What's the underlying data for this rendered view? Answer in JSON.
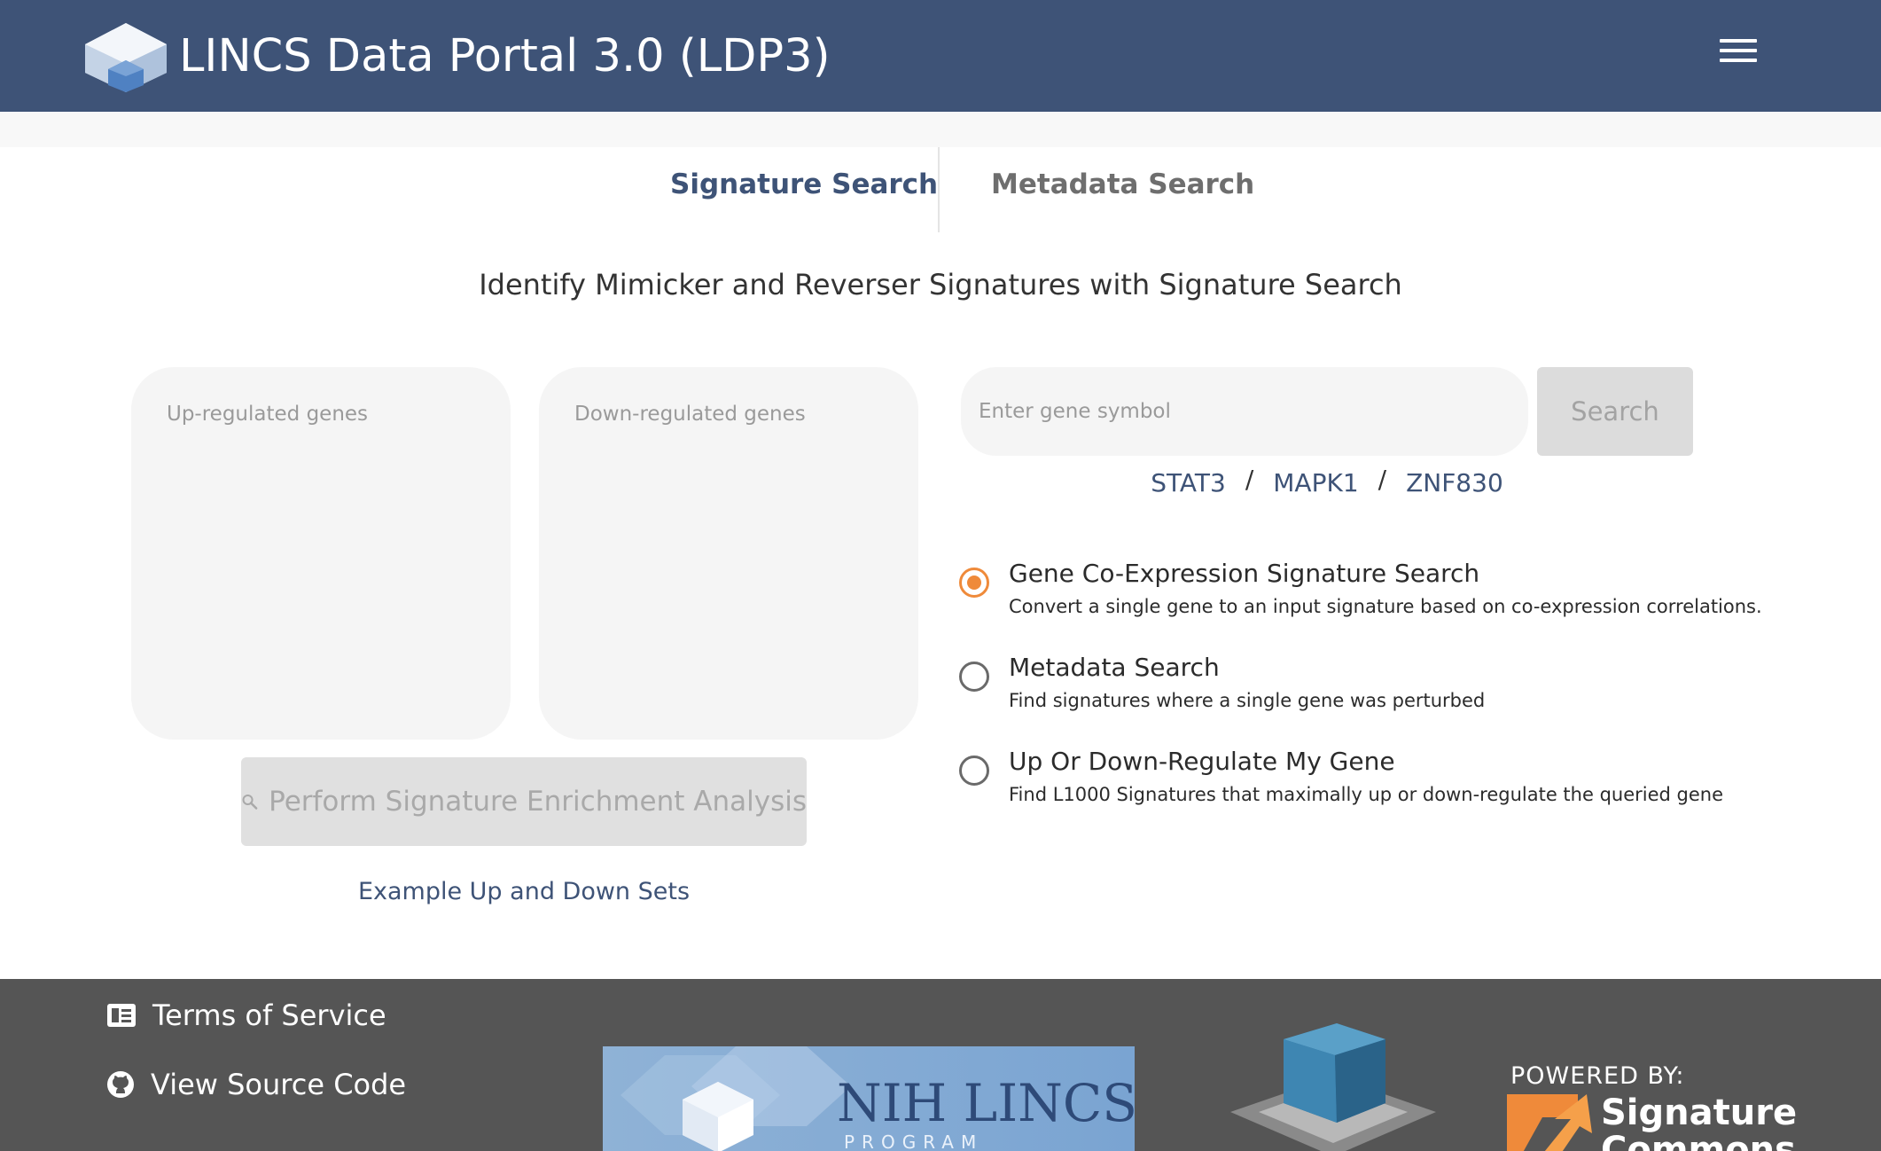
{
  "header": {
    "title": "LINCS Data Portal 3.0 (LDP3)",
    "logo_icon": "lincs-cube-logo",
    "menu_icon": "hamburger-menu-icon",
    "background_color": "#3e5377"
  },
  "tabs": [
    {
      "label": "Signature Search",
      "active": true
    },
    {
      "label": "Metadata Search",
      "active": false
    }
  ],
  "headline": "Identify Mimicker and Reverser Signatures with Signature Search",
  "signature_input": {
    "up_placeholder": "Up-regulated genes",
    "down_placeholder": "Down-regulated genes",
    "enrich_button_label": "Perform Signature Enrichment Analysis",
    "example_link": "Example Up and Down Sets"
  },
  "gene_search": {
    "placeholder": "Enter gene symbol",
    "button_label": "Search",
    "examples": [
      "STAT3",
      "MAPK1",
      "ZNF830"
    ],
    "separator": "/"
  },
  "search_modes": [
    {
      "title": "Gene Co-Expression Signature Search",
      "description": "Convert a single gene to an input signature based on co-expression correlations.",
      "selected": true
    },
    {
      "title": "Metadata Search",
      "description": "Find signatures where a single gene was perturbed",
      "selected": false
    },
    {
      "title": "Up Or Down-Regulate My Gene",
      "description": "Find L1000 Signatures that maximally up or down-regulate the queried gene",
      "selected": false
    }
  ],
  "footer": {
    "links": [
      {
        "label": "Terms of Service",
        "icon": "document-icon"
      },
      {
        "label": "View Source Code",
        "icon": "github-icon"
      }
    ],
    "nih_banner": {
      "title": "NIH LINCS",
      "subtitle": "PROGRAM"
    },
    "powered_by": "POWERED BY:",
    "sigcom_name": "Signature",
    "sigcom_name_2": "Commons",
    "accent_color": "#ef8a3a"
  }
}
